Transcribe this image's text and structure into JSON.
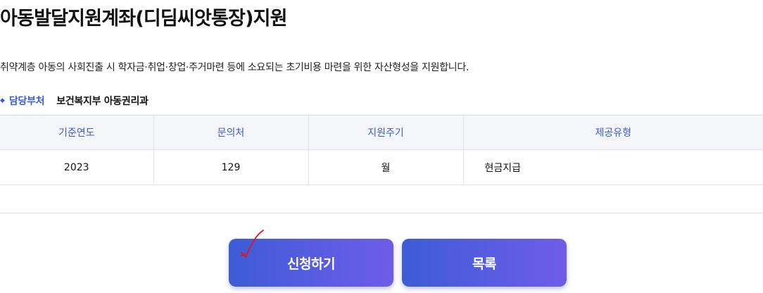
{
  "page": {
    "title": "아동발달지원계좌(디딤씨앗통장)지원",
    "description": "취약계층 아동의 사회진출 시 학자금·취업·창업·주거마련 등에 소요되는 초기비용 마련을 위한 자산형성을 지원합니다."
  },
  "department": {
    "bullet": "◆",
    "label": "담당부처",
    "value": "보건복지부 아동권리과"
  },
  "table": {
    "headers": [
      "기준연도",
      "문의처",
      "지원주기",
      "제공유형"
    ],
    "row": [
      "2023",
      "129",
      "월",
      "현금지급"
    ]
  },
  "buttons": {
    "apply_label": "신청하기",
    "list_label": "목록"
  },
  "colors": {
    "accent": "#3b5bd6",
    "button_gradient_start": "#3d5cd6",
    "button_gradient_end": "#6f5ce9",
    "check_mark": "#e0141a"
  },
  "icons": {
    "department_bullet": "diamond-bullet-icon",
    "apply_mark": "red-check-icon"
  }
}
